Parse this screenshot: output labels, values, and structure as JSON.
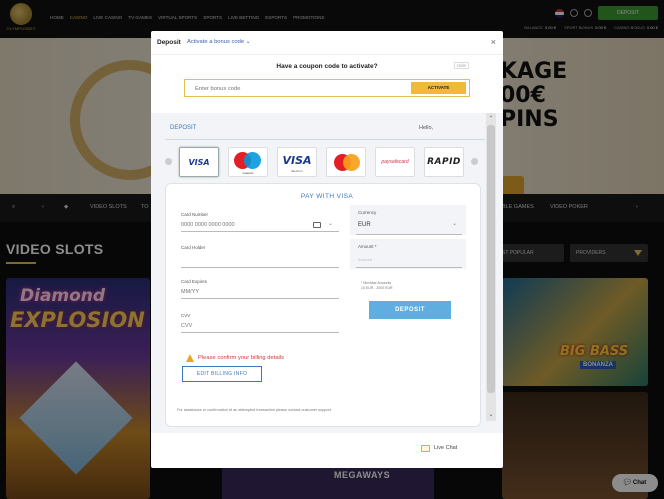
{
  "logo": {
    "text": "OLYMPUSBET"
  },
  "nav": [
    "HOME",
    "CASINO",
    "LIVE CASINO",
    "TV GAMES",
    "VIRTUAL SPORTS",
    "SPORTS",
    "LIVE BETTING",
    "ESPORTS",
    "PROMOTIONS"
  ],
  "header": {
    "deposit_label": "DEPOSIT",
    "balances": [
      {
        "label": "BALANCE",
        "value": "0.00 €"
      },
      {
        "label": "SPORT BONUS",
        "value": "0.00 €"
      },
      {
        "label": "CASINO BONUS",
        "value": "0.00 €"
      }
    ]
  },
  "hero": {
    "line1": "KAGE",
    "line2": "00€",
    "line3": "PINS"
  },
  "categories": {
    "video_slots": "VIDEO SLOTS",
    "to": "TO",
    "table_games": "BLE GAMES",
    "video_poker": "VIDEO POKER"
  },
  "section": {
    "title": "VIDEO SLOTS",
    "sort": "ST POPULAR",
    "providers": "PROVIDERS"
  },
  "tiles": {
    "diamond1": "Diamond",
    "diamond2": "EXPLOSION",
    "bigbass": "BIG BASS",
    "bonanza": "BONANZA",
    "megaways": "MEGAWAYS"
  },
  "chat": {
    "label": "Chat"
  },
  "modal": {
    "title": "Deposit",
    "activate_link": "Activate a bonus code",
    "close": "×",
    "coupon_question": "Have a coupon code to activate?",
    "coupon_hide": "Hide",
    "coupon_placeholder": "Enter bonus code",
    "activate_button": "ACTIVATE",
    "tab_deposit": "DEPOSIT",
    "tab_hello": "Hello,",
    "payment_methods": [
      {
        "name": "VISA",
        "selected": true
      },
      {
        "name": "Maestro",
        "sub": "maestro"
      },
      {
        "name": "VISA",
        "sub": "Electron"
      },
      {
        "name": "Mastercard"
      },
      {
        "name": "paysafecard",
        "text": "paysafecard"
      },
      {
        "name": "RAPID",
        "text": "RAPID"
      }
    ],
    "pay_title": "PAY WITH VISA",
    "card_number": {
      "label": "Card Number",
      "placeholder": "0000 0000 0000 0000"
    },
    "card_holder": {
      "label": "Card Holder"
    },
    "card_expires": {
      "label": "Card Expires",
      "placeholder": "MM/YY"
    },
    "cvv": {
      "label": "CVV",
      "placeholder": "CVV"
    },
    "currency": {
      "label": "Currency",
      "value": "EUR"
    },
    "amount": {
      "label": "Amount *",
      "placeholder": "Amount"
    },
    "limits": {
      "line1": "* Min/Max Amounts",
      "line2": "10 EUR - 2000 EUR"
    },
    "deposit_button": "DEPOSIT",
    "warning": "Please confirm your billing details",
    "edit_billing": "EDIT BILLING INFO",
    "footnote": "For assistance or confirmation of an attempted transaction please contact customer support.",
    "live_chat": "Live Chat"
  },
  "colors": {
    "accent_gold": "#e8c35b",
    "deposit_green": "#3f9b32",
    "link_blue": "#3a78c3",
    "warning_red": "#d23a3a"
  }
}
